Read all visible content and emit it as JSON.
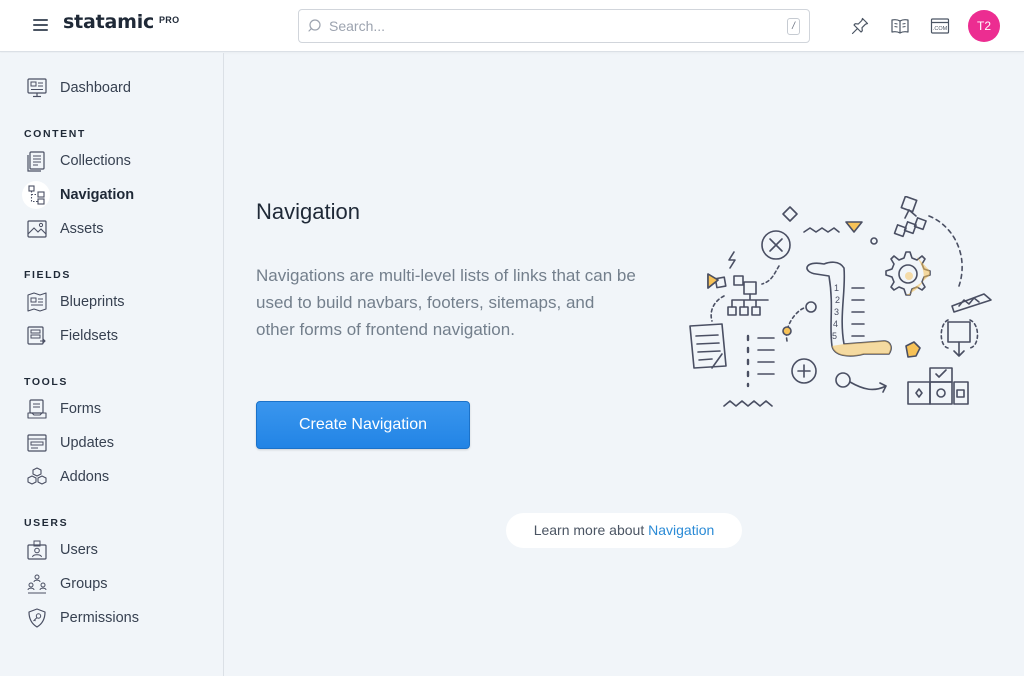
{
  "app": {
    "logo": "statamic",
    "logo_badge": "PRO"
  },
  "search": {
    "placeholder": "Search...",
    "shortcut": "/"
  },
  "header_icons": [
    "pin-icon",
    "docs-book-icon",
    "site-com-icon"
  ],
  "user": {
    "initials": "T2",
    "avatar_color": "#ec2d91"
  },
  "sidebar": {
    "dashboard": "Dashboard",
    "sections": {
      "content": "CONTENT",
      "fields": "FIELDS",
      "tools": "TOOLS",
      "users": "USERS"
    },
    "items": {
      "collections": "Collections",
      "navigation": "Navigation",
      "assets": "Assets",
      "blueprints": "Blueprints",
      "fieldsets": "Fieldsets",
      "forms": "Forms",
      "updates": "Updates",
      "addons": "Addons",
      "users": "Users",
      "groups": "Groups",
      "permissions": "Permissions"
    },
    "active": "Navigation"
  },
  "main": {
    "title": "Navigation",
    "description": "Navigations are multi-level lists of links that can be used to build navbars, footers, sitemaps, and other forms of frontend navigation.",
    "create_button": "Create Navigation",
    "learn_more_prefix": "Learn more about",
    "learn_more_link": "Navigation"
  },
  "colors": {
    "primary_button": "#2284e5",
    "link": "#2b8bd6",
    "illustration_accent": "#f7c257",
    "illustration_stroke": "#4a4f63"
  }
}
